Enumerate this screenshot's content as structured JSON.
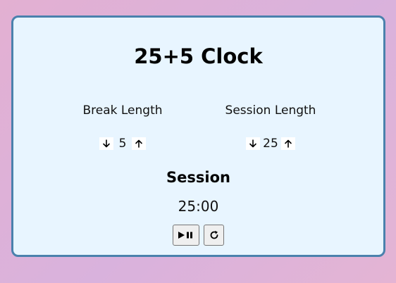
{
  "title": "25+5 Clock",
  "break": {
    "label": "Break Length",
    "value": "5",
    "decrement_icon": "arrow-down-icon",
    "increment_icon": "arrow-up-icon"
  },
  "session": {
    "label": "Session Length",
    "value": "25",
    "decrement_icon": "arrow-down-icon",
    "increment_icon": "arrow-up-icon"
  },
  "timer": {
    "label": "Session",
    "time_left": "25:00"
  },
  "controls": {
    "play_pause_icon": "play-pause-icon",
    "reset_icon": "refresh-icon"
  },
  "colors": {
    "card_background": "#e8f5ff",
    "card_border": "#4a81ad"
  }
}
